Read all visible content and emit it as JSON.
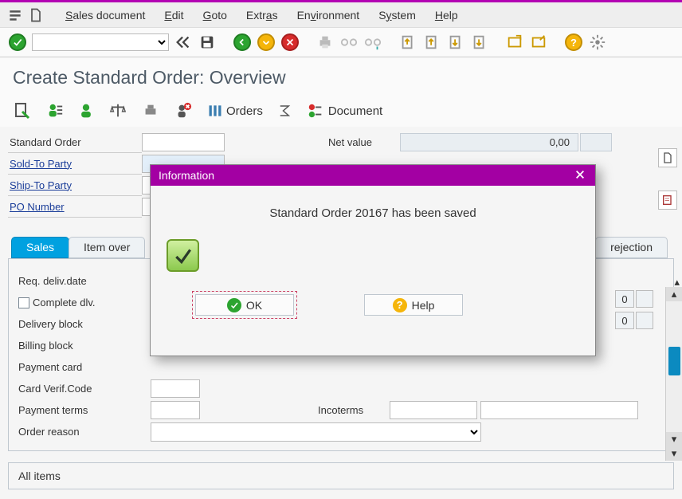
{
  "menu": {
    "sales_doc": "Sales document",
    "edit": "Edit",
    "goto": "Goto",
    "extras": "Extras",
    "environment": "Environment",
    "system": "System",
    "help": "Help"
  },
  "title": "Create Standard Order: Overview",
  "app_toolbar": {
    "orders": "Orders",
    "document": "Document"
  },
  "header": {
    "standard_order_label": "Standard Order",
    "sold_to_label": "Sold-To Party",
    "ship_to_label": "Ship-To Party",
    "po_number_label": "PO Number",
    "net_value_label": "Net value",
    "net_value": "0,00",
    "standard_order": "",
    "sold_to": "",
    "ship_to": "",
    "po_number": ""
  },
  "tabs": {
    "sales": "Sales",
    "item_overview": "Item over",
    "rejection": "rejection"
  },
  "sales_tab": {
    "req_deliv_date": "Req. deliv.date",
    "complete_dlv": "Complete dlv.",
    "delivery_block": "Delivery block",
    "billing_block": "Billing block",
    "payment_card": "Payment card",
    "card_verif": "Card Verif.Code",
    "payment_terms": "Payment terms",
    "order_reason": "Order reason",
    "incoterms": "Incoterms",
    "num0a": "0",
    "num0b": "0"
  },
  "all_items": "All items",
  "modal": {
    "title": "Information",
    "message": "Standard Order 20167 has been saved",
    "ok": "OK",
    "help": "Help"
  }
}
